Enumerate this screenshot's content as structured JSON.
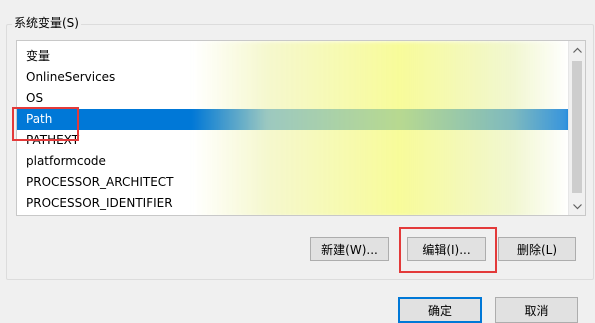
{
  "group": {
    "title": "系统变量(S)"
  },
  "variables": [
    {
      "name": "变量"
    },
    {
      "name": "OnlineServices"
    },
    {
      "name": "OS"
    },
    {
      "name": "Path",
      "selected": true
    },
    {
      "name": "PATHEXT"
    },
    {
      "name": "platformcode"
    },
    {
      "name": "PROCESSOR_ARCHITECT"
    },
    {
      "name": "PROCESSOR_IDENTIFIER"
    }
  ],
  "buttons": {
    "new": "新建(W)...",
    "edit": "编辑(I)...",
    "delete": "删除(L)",
    "ok": "确定",
    "cancel": "取消"
  },
  "colors": {
    "selection": "#0078d7",
    "annotation": "#e33a3a"
  },
  "icons": {
    "scroll_up": "chevron-up-icon",
    "scroll_down": "chevron-down-icon"
  }
}
